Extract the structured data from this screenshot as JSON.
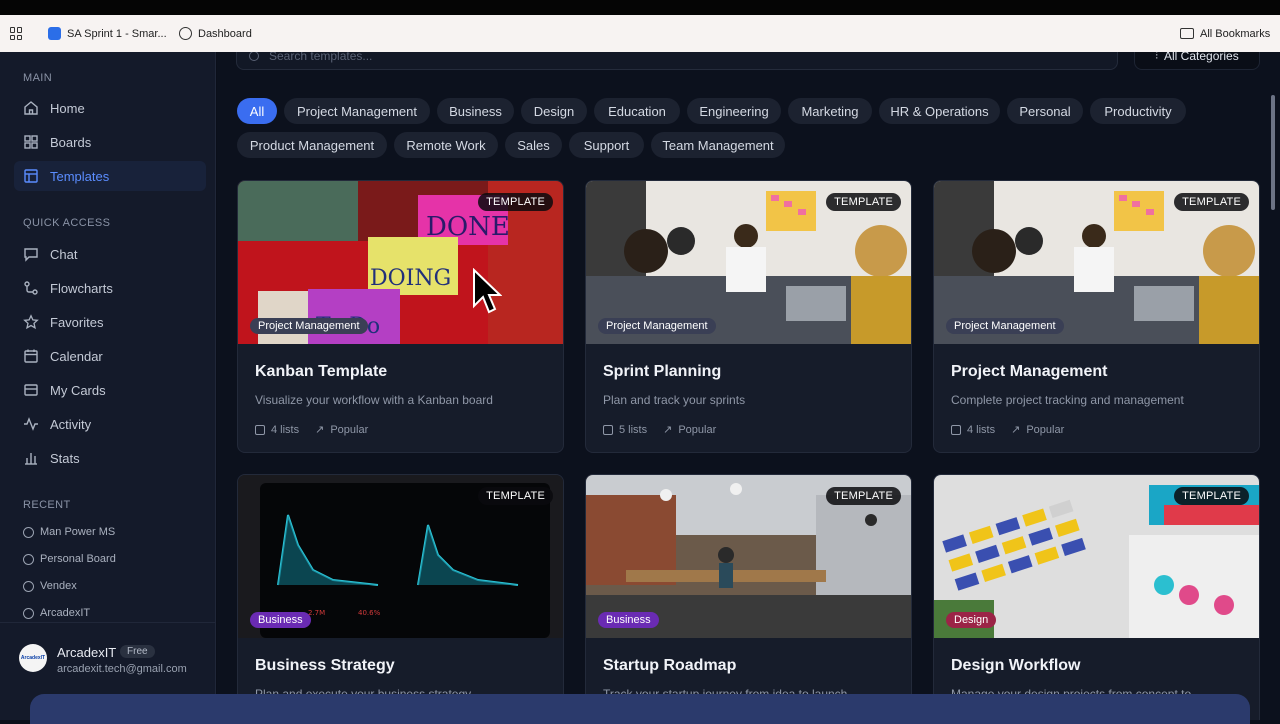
{
  "browser": {
    "bookmarks": [
      {
        "label": "SA Sprint 1 - Smar..."
      },
      {
        "label": "Dashboard"
      }
    ],
    "all_bookmarks": "All Bookmarks"
  },
  "sidebar": {
    "main_title": "MAIN",
    "main_items": [
      {
        "label": "Home",
        "icon": "home-icon"
      },
      {
        "label": "Boards",
        "icon": "boards-icon"
      },
      {
        "label": "Templates",
        "icon": "templates-icon",
        "active": true
      }
    ],
    "quick_title": "QUICK ACCESS",
    "quick_items": [
      {
        "label": "Chat",
        "icon": "chat-icon"
      },
      {
        "label": "Flowcharts",
        "icon": "flowchart-icon"
      },
      {
        "label": "Favorites",
        "icon": "star-icon"
      },
      {
        "label": "Calendar",
        "icon": "calendar-icon"
      },
      {
        "label": "My Cards",
        "icon": "cards-icon"
      },
      {
        "label": "Activity",
        "icon": "activity-icon"
      },
      {
        "label": "Stats",
        "icon": "stats-icon"
      }
    ],
    "recent_title": "RECENT",
    "recent_items": [
      "Man Power MS",
      "Personal Board",
      "Vendex",
      "ArcadexIT"
    ],
    "user": {
      "avatar_text": "ArcadexIT",
      "name": "ArcadexIT",
      "plan": "Free",
      "email": "arcadexit.tech@gmail.com"
    }
  },
  "main": {
    "search_placeholder": "Search templates...",
    "category_button": "All Categories",
    "chips": [
      "All",
      "Project Management",
      "Business",
      "Design",
      "Education",
      "Engineering",
      "Marketing",
      "HR & Operations",
      "Personal",
      "Productivity",
      "Product Management",
      "Remote Work",
      "Sales",
      "Support",
      "Team Management"
    ],
    "active_chip": "All",
    "template_badge": "TEMPLATE",
    "popular_label": "Popular",
    "cards": [
      {
        "title": "Kanban Template",
        "desc": "Visualize your workflow with a Kanban board",
        "category": "Project Management",
        "lists": "4 lists",
        "tag_color": "#3a3f55",
        "thumb": "kanban"
      },
      {
        "title": "Sprint Planning",
        "desc": "Plan and track your sprints",
        "category": "Project Management",
        "lists": "5 lists",
        "tag_color": "#3a3f55",
        "thumb": "meeting"
      },
      {
        "title": "Project Management",
        "desc": "Complete project tracking and management",
        "category": "Project Management",
        "lists": "4 lists",
        "tag_color": "#3a3f55",
        "thumb": "meeting"
      },
      {
        "title": "Business Strategy",
        "desc": "Plan and execute your business strategy",
        "category": "Business",
        "lists": "",
        "tag_color": "#6a2bb3",
        "thumb": "analytics"
      },
      {
        "title": "Startup Roadmap",
        "desc": "Track your startup journey from idea to launch",
        "category": "Business",
        "lists": "",
        "tag_color": "#6a2bb3",
        "thumb": "office"
      },
      {
        "title": "Design Workflow",
        "desc": "Manage your design projects from concept to",
        "category": "Design",
        "lists": "",
        "tag_color": "#9b2447",
        "thumb": "swatches"
      }
    ],
    "colors": {
      "accent": "#3a6df0",
      "active_nav": "#5b8dff"
    }
  }
}
